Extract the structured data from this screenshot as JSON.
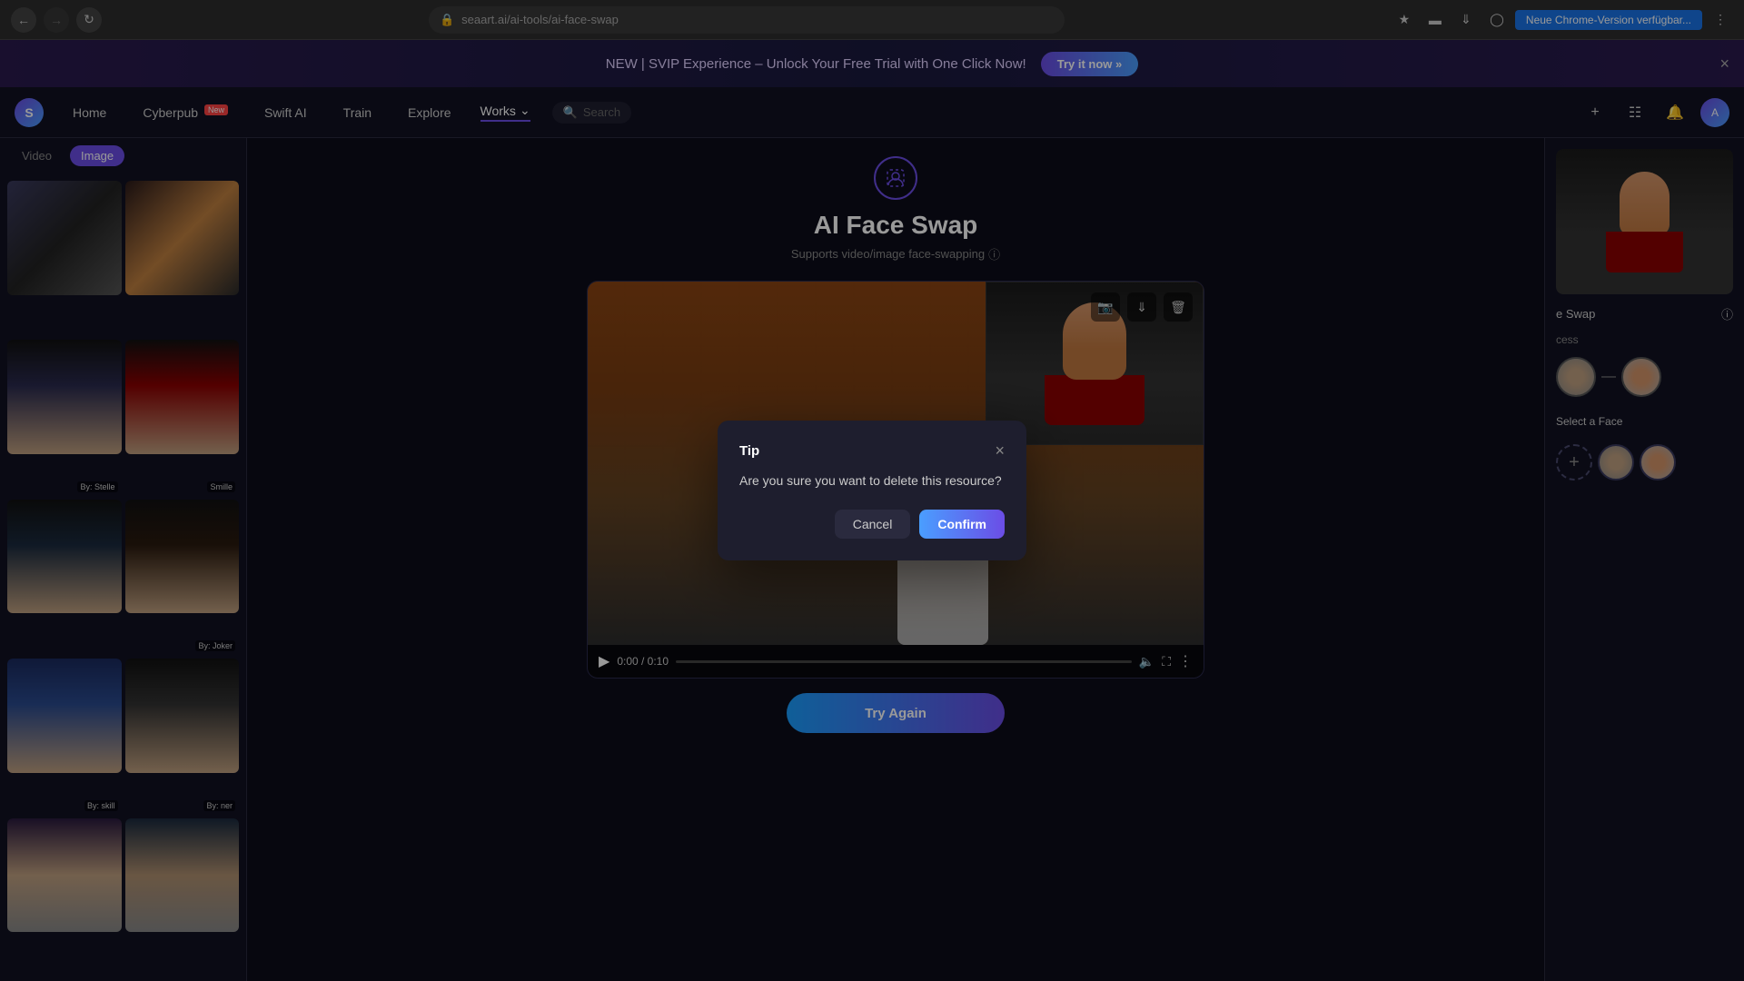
{
  "browser": {
    "url": "seaart.ai/ai-tools/ai-face-swap",
    "back_disabled": false,
    "forward_disabled": false,
    "update_button": "Neue Chrome-Version verfügbar..."
  },
  "banner": {
    "text": "NEW | SVIP Experience – Unlock Your Free Trial with One Click Now!",
    "cta_label": "Try it now »",
    "close_label": "×"
  },
  "nav": {
    "logo": "S",
    "items": [
      {
        "label": "Home",
        "active": false
      },
      {
        "label": "Cyberpub",
        "active": false,
        "badge": "New"
      },
      {
        "label": "Swift AI",
        "active": false
      },
      {
        "label": "Train",
        "active": false
      },
      {
        "label": "Explore",
        "active": false
      },
      {
        "label": "Works",
        "active": true
      }
    ],
    "search_placeholder": "Search"
  },
  "sidebar": {
    "tabs": [
      {
        "label": "Video",
        "active": false
      },
      {
        "label": "Image",
        "active": true
      }
    ],
    "gallery_items": [
      {
        "id": "top1",
        "color_class": "img-top1"
      },
      {
        "id": "top2",
        "color_class": "img-top2"
      },
      {
        "id": "asian-man",
        "color_class": "img-asian-man",
        "label": "By: Stelle"
      },
      {
        "id": "red-bow",
        "color_class": "img-red-bow",
        "label": "Smille"
      },
      {
        "id": "korean-man",
        "color_class": "img-korean-man"
      },
      {
        "id": "kimono",
        "color_class": "img-kimono",
        "label": "By: Joker"
      },
      {
        "id": "cap-america",
        "color_class": "img-cap-america",
        "label": "By: skill"
      },
      {
        "id": "teen",
        "color_class": "img-teen",
        "label": "By: ner"
      },
      {
        "id": "face1",
        "color_class": "img-face1"
      },
      {
        "id": "face2",
        "color_class": "img-face2"
      }
    ]
  },
  "page": {
    "icon": "⊙",
    "title": "AI Face Swap",
    "subtitle": "Supports video/image face-swapping",
    "help_icon": "?"
  },
  "video_player": {
    "time_current": "0:00",
    "time_total": "0:10",
    "time_display": "0:00 / 0:10"
  },
  "right_panel": {
    "face_swap_label": "e Swap",
    "help_icon": "?",
    "process_label": "cess",
    "select_face_label": "Select a Face",
    "add_face_label": "+"
  },
  "dialog": {
    "title": "Tip",
    "message": "Are you sure you want to delete this resource?",
    "cancel_label": "Cancel",
    "confirm_label": "Confirm",
    "close_label": "×"
  },
  "try_again": {
    "label": "Try Again"
  }
}
